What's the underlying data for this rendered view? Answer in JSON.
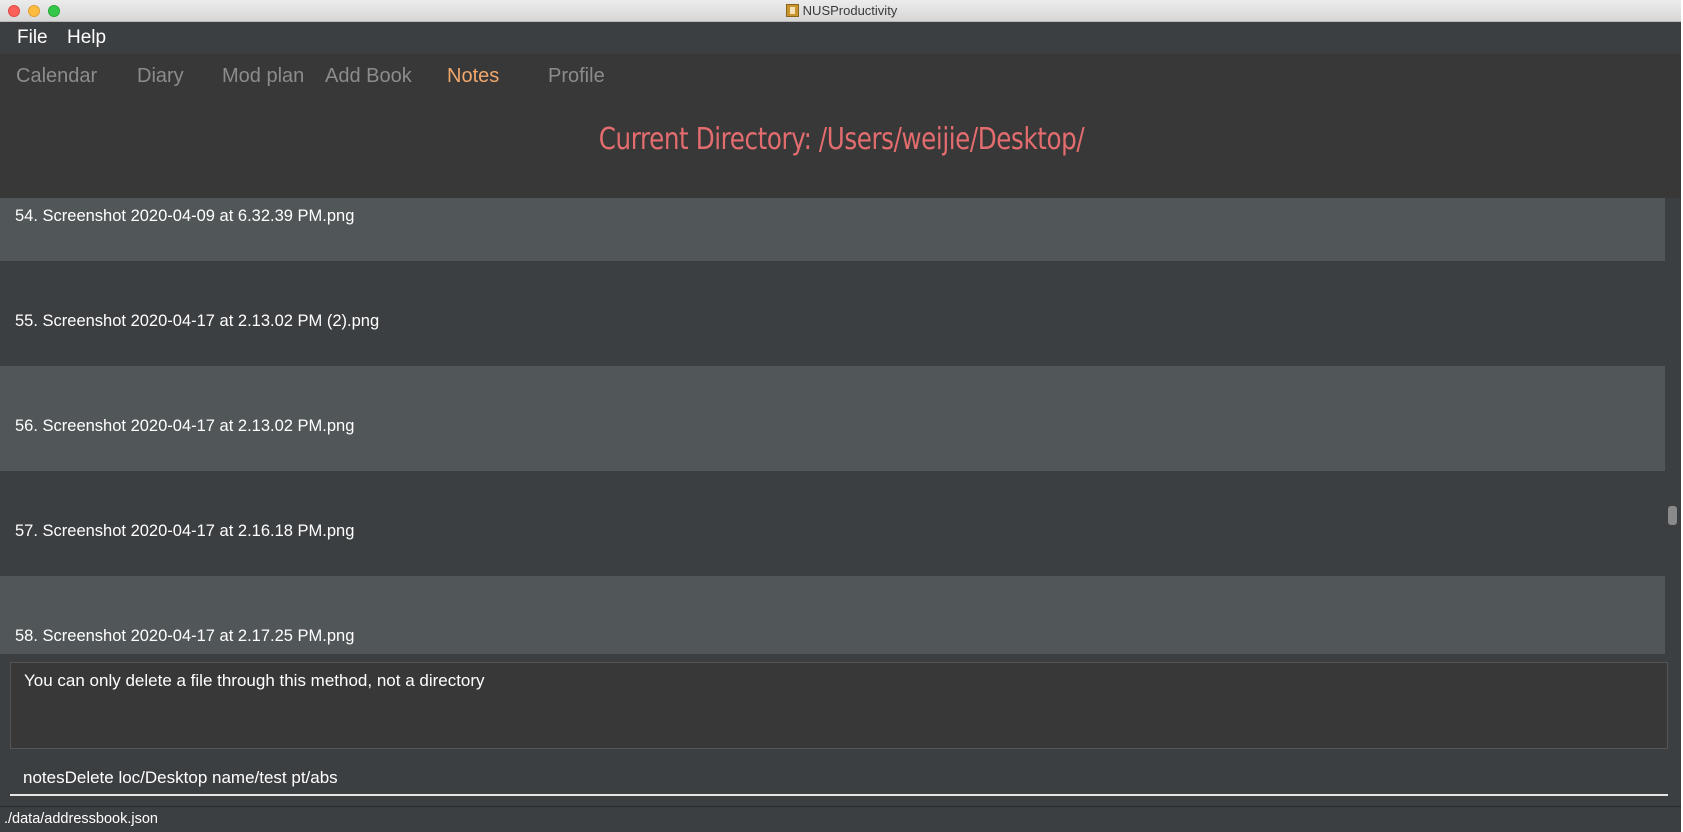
{
  "window": {
    "title": "NUSProductivity"
  },
  "menu": {
    "items": [
      {
        "label": "File"
      },
      {
        "label": "Help"
      }
    ]
  },
  "tabs": {
    "items": [
      {
        "label": "Calendar",
        "active": false
      },
      {
        "label": "Diary",
        "active": false
      },
      {
        "label": "Mod plan",
        "active": false
      },
      {
        "label": "Add Book",
        "active": false
      },
      {
        "label": "Notes",
        "active": true
      },
      {
        "label": "Profile",
        "active": false
      }
    ],
    "active_color": "#f0a76b",
    "inactive_color": "#8c8c8c"
  },
  "notes": {
    "directory_label": "Current Directory: /Users/weijie/Desktop/",
    "files": [
      {
        "text": "54.  Screenshot 2020-04-09 at 6.32.39 PM.png"
      },
      {
        "text": "55.  Screenshot 2020-04-17 at 2.13.02 PM (2).png"
      },
      {
        "text": "56.  Screenshot 2020-04-17 at 2.13.02 PM.png"
      },
      {
        "text": "57.  Screenshot 2020-04-17 at 2.16.18 PM.png"
      },
      {
        "text": "58.  Screenshot 2020-04-17 at 2.17.25 PM.png"
      }
    ]
  },
  "result": {
    "message": "You can only delete a file through this method, not a directory"
  },
  "command": {
    "value": "notesDelete loc/Desktop name/test pt/abs"
  },
  "status": {
    "path": "./data/addressbook.json"
  },
  "colors": {
    "background": "#3c3f41",
    "row_light": "#515658",
    "row_dark": "#3c3f41",
    "directory_title": "#e36c6f"
  },
  "icons": {
    "app": "app-icon",
    "close": "close-icon",
    "minimize": "minimize-icon",
    "zoom": "zoom-icon"
  }
}
